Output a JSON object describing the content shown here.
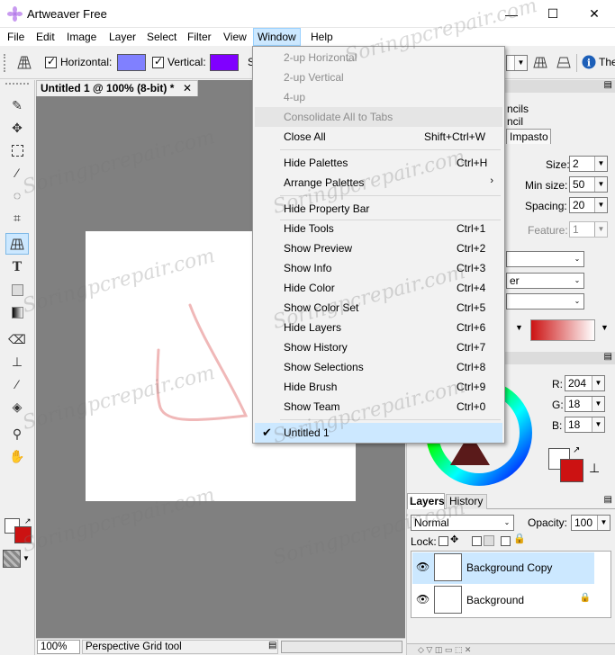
{
  "window": {
    "title": "Artweaver Free",
    "min_glyph": "—",
    "max_glyph": "☐",
    "close_glyph": "✕"
  },
  "menubar": {
    "items": [
      "File",
      "Edit",
      "Image",
      "Layer",
      "Select",
      "Filter",
      "View",
      "Window",
      "Help"
    ],
    "active": "Window"
  },
  "propbar": {
    "horizontal_label": "Horizontal:",
    "vertical_label": "Vertical:",
    "horizontal_color": "#8080ff",
    "vertical_color": "#8000ff",
    "s_label": "S",
    "info_truncated": "The"
  },
  "document": {
    "tab_title": "Untitled 1 @ 100% (8-bit) *",
    "close_glyph": "✕",
    "canvas_bg": "#ffffff",
    "area_bg": "#808080"
  },
  "statusbar": {
    "zoom": "100%",
    "tool_name": "Perspective Grid tool"
  },
  "brush_panel": {
    "header_line1": "ncils",
    "header_line2": "ncil",
    "tab_impasto": "Impasto",
    "size_label": "Size:",
    "size_value": "2",
    "min_size_label": "Min size:",
    "min_size_value": "50",
    "spacing_label": "Spacing:",
    "spacing_value": "20",
    "feature_label": "Feature:",
    "feature_value": "1",
    "combo_er_text": "er"
  },
  "color_panel": {
    "r_label": "R:",
    "r_value": "204",
    "g_label": "G:",
    "g_value": "18",
    "b_label": "B:",
    "b_value": "18",
    "primary_color": "#cc1212",
    "secondary_color": "#ffffff"
  },
  "layers_panel": {
    "tab_layers": "Layers",
    "tab_history": "History",
    "blend_mode": "Normal",
    "opacity_label": "Opacity:",
    "opacity_value": "100",
    "lock_label": "Lock:",
    "layers": [
      {
        "name": "Background Copy",
        "selected": true
      },
      {
        "name": "Background",
        "selected": false
      }
    ]
  },
  "window_menu": {
    "items": [
      {
        "label": "2-up Horizontal",
        "shortcut": "",
        "disabled": true
      },
      {
        "label": "2-up Vertical",
        "shortcut": "",
        "disabled": true
      },
      {
        "label": "4-up",
        "shortcut": "",
        "disabled": true
      },
      {
        "label": "Consolidate All to Tabs",
        "shortcut": "",
        "disabled": true
      },
      {
        "label": "Close All",
        "shortcut": "Shift+Ctrl+W",
        "disabled": false
      },
      {
        "label": "Hide Palettes",
        "shortcut": "Ctrl+H",
        "disabled": false
      },
      {
        "label": "Arrange Palettes",
        "shortcut": "",
        "disabled": false,
        "submenu": true
      },
      {
        "label": "Hide Property Bar",
        "shortcut": "",
        "disabled": false
      },
      {
        "label": "Hide Tools",
        "shortcut": "Ctrl+1",
        "disabled": false
      },
      {
        "label": "Show Preview",
        "shortcut": "Ctrl+2",
        "disabled": false
      },
      {
        "label": "Show Info",
        "shortcut": "Ctrl+3",
        "disabled": false
      },
      {
        "label": "Hide Color",
        "shortcut": "Ctrl+4",
        "disabled": false
      },
      {
        "label": "Show Color Set",
        "shortcut": "Ctrl+5",
        "disabled": false
      },
      {
        "label": "Hide Layers",
        "shortcut": "Ctrl+6",
        "disabled": false
      },
      {
        "label": "Show History",
        "shortcut": "Ctrl+7",
        "disabled": false
      },
      {
        "label": "Show Selections",
        "shortcut": "Ctrl+8",
        "disabled": false
      },
      {
        "label": "Hide Brush",
        "shortcut": "Ctrl+9",
        "disabled": false
      },
      {
        "label": "Show Team",
        "shortcut": "Ctrl+0",
        "disabled": false
      },
      {
        "label": "Untitled 1",
        "shortcut": "",
        "disabled": false,
        "checked": true
      }
    ],
    "check_glyph": "✔",
    "submenu_glyph": "›"
  },
  "watermark": {
    "text": "Soringpcrepair.com"
  },
  "icons": {
    "tools": [
      "brush-icon",
      "move-icon",
      "marquee-icon",
      "magic-wand-icon",
      "lasso-icon",
      "crop-icon",
      "perspective-grid-icon",
      "text-icon",
      "shape-icon",
      "gradient-icon",
      "eraser-icon",
      "stamp-icon",
      "eyedropper-icon",
      "fill-icon",
      "zoom-icon",
      "hand-icon"
    ]
  }
}
